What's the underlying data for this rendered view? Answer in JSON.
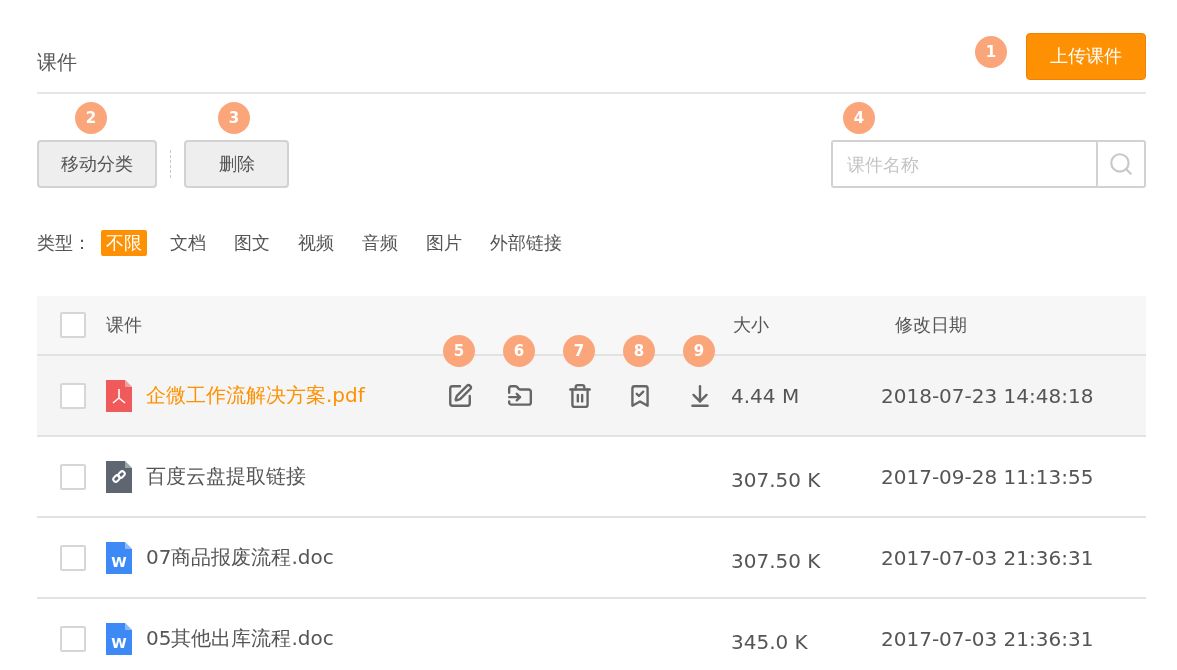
{
  "header": {
    "title": "课件",
    "upload_button": "上传课件",
    "marker": "1"
  },
  "toolbar": {
    "buttons": [
      {
        "label": "移动分类",
        "marker": "2"
      },
      {
        "label": "删除",
        "marker": "3"
      }
    ],
    "search": {
      "placeholder": "课件名称",
      "marker": "4"
    }
  },
  "filter": {
    "label": "类型：",
    "options": [
      {
        "label": "不限",
        "selected": true
      },
      {
        "label": "文档",
        "selected": false
      },
      {
        "label": "图文",
        "selected": false
      },
      {
        "label": "视频",
        "selected": false
      },
      {
        "label": "音频",
        "selected": false
      },
      {
        "label": "图片",
        "selected": false
      },
      {
        "label": "外部链接",
        "selected": false
      }
    ]
  },
  "table": {
    "columns": [
      "课件",
      "大小",
      "修改日期"
    ],
    "header_checked": false,
    "rows": [
      {
        "kind": "pdf",
        "name": "企微工作流解决方案.pdf",
        "size": "4.44 M",
        "date": "2018-07-23 14:48:18",
        "checked": false,
        "highlighted": true,
        "actions": [
          {
            "kind": "edit",
            "marker": "5"
          },
          {
            "kind": "move",
            "marker": "6"
          },
          {
            "kind": "delete",
            "marker": "7"
          },
          {
            "kind": "approve",
            "marker": "8"
          },
          {
            "kind": "download",
            "marker": "9"
          }
        ]
      },
      {
        "kind": "link",
        "name": "百度云盘提取链接",
        "size": "307.50 K",
        "date": "2017-09-28 11:13:55",
        "checked": false,
        "highlighted": false
      },
      {
        "kind": "doc",
        "icon_text": "W",
        "name": "07商品报废流程.doc",
        "size": "307.50 K",
        "date": "2017-07-03 21:36:31",
        "checked": false,
        "highlighted": false
      },
      {
        "kind": "doc",
        "icon_text": "W",
        "name": "05其他出库流程.doc",
        "size": "345.0 K",
        "date": "2017-07-03 21:36:31",
        "checked": false,
        "highlighted": false
      }
    ]
  }
}
